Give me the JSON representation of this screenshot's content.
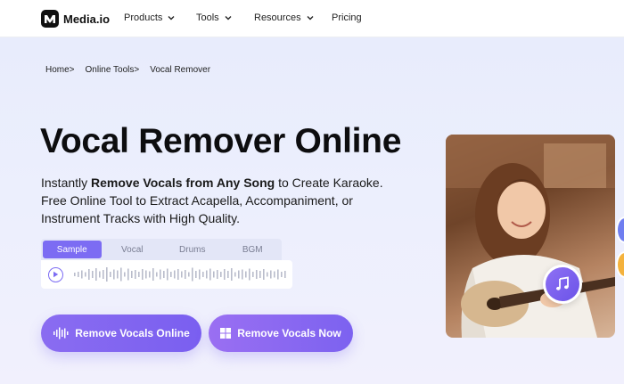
{
  "brand": {
    "name": "Media.io"
  },
  "nav": {
    "items": [
      {
        "label": "Products",
        "has_menu": true
      },
      {
        "label": "Tools",
        "has_menu": true
      },
      {
        "label": "Resources",
        "has_menu": true
      },
      {
        "label": "Pricing",
        "has_menu": false
      }
    ]
  },
  "breadcrumb": [
    "Home>",
    "Online Tools>",
    "Vocal Remover"
  ],
  "hero": {
    "title": "Vocal Remover Online",
    "desc_pre": "Instantly ",
    "desc_bold": "Remove Vocals from Any Song",
    "desc_post": " to Create Karaoke. Free Online Tool to Extract Acapella, Accompaniment, or Instrument Tracks with High Quality."
  },
  "player": {
    "tabs": [
      "Sample",
      "Vocal",
      "Drums",
      "BGM"
    ],
    "active_tab": "Sample"
  },
  "buttons": {
    "primary": "Remove Vocals Online",
    "secondary": "Remove Vocals Now"
  },
  "colors": {
    "accent": "#7c6cf3",
    "hero_bg": "#e8ecfc"
  },
  "icons": {
    "play": "play-icon",
    "waveform": "waveform-icon",
    "windows": "windows-icon",
    "music": "music-note-icon"
  }
}
